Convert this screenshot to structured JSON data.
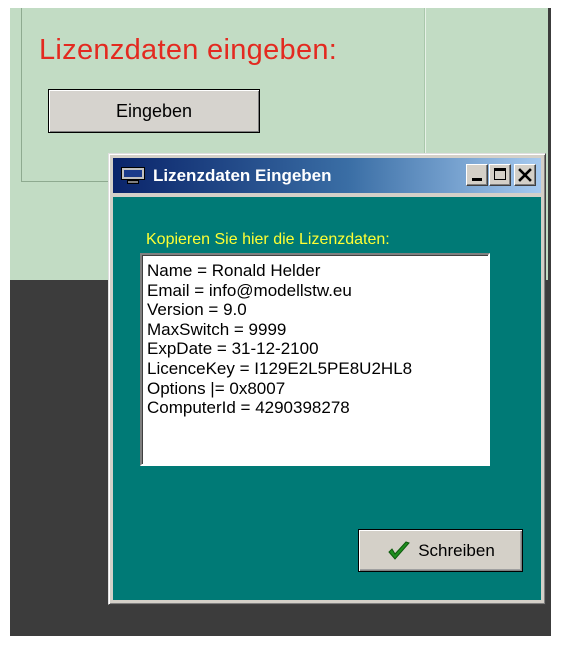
{
  "parent_window": {
    "title": "Lizenzdaten eingeben:",
    "button_label": "Eingeben",
    "title_color": "#e32a20",
    "panel_color": "#c2dcc4"
  },
  "dialog": {
    "title": "Lizenzdaten Eingeben",
    "window_buttons": [
      "minimize-icon",
      "maximize-icon",
      "close-icon"
    ],
    "prompt": "Kopieren Sie hier die Lizenzdaten:",
    "prompt_color": "#ffff33",
    "background_color": "#007a76",
    "license_lines": [
      "Name = Ronald Helder",
      "Email  = info@modellstw.eu",
      "Version = 9.0",
      "MaxSwitch = 9999",
      "ExpDate = 31-12-2100",
      "LicenceKey = I129E2L5PE8U2HL8",
      "Options |= 0x8007",
      "ComputerId = 4290398278"
    ],
    "write_button": {
      "label": "Schreiben",
      "icon": "checkmark-icon"
    }
  }
}
